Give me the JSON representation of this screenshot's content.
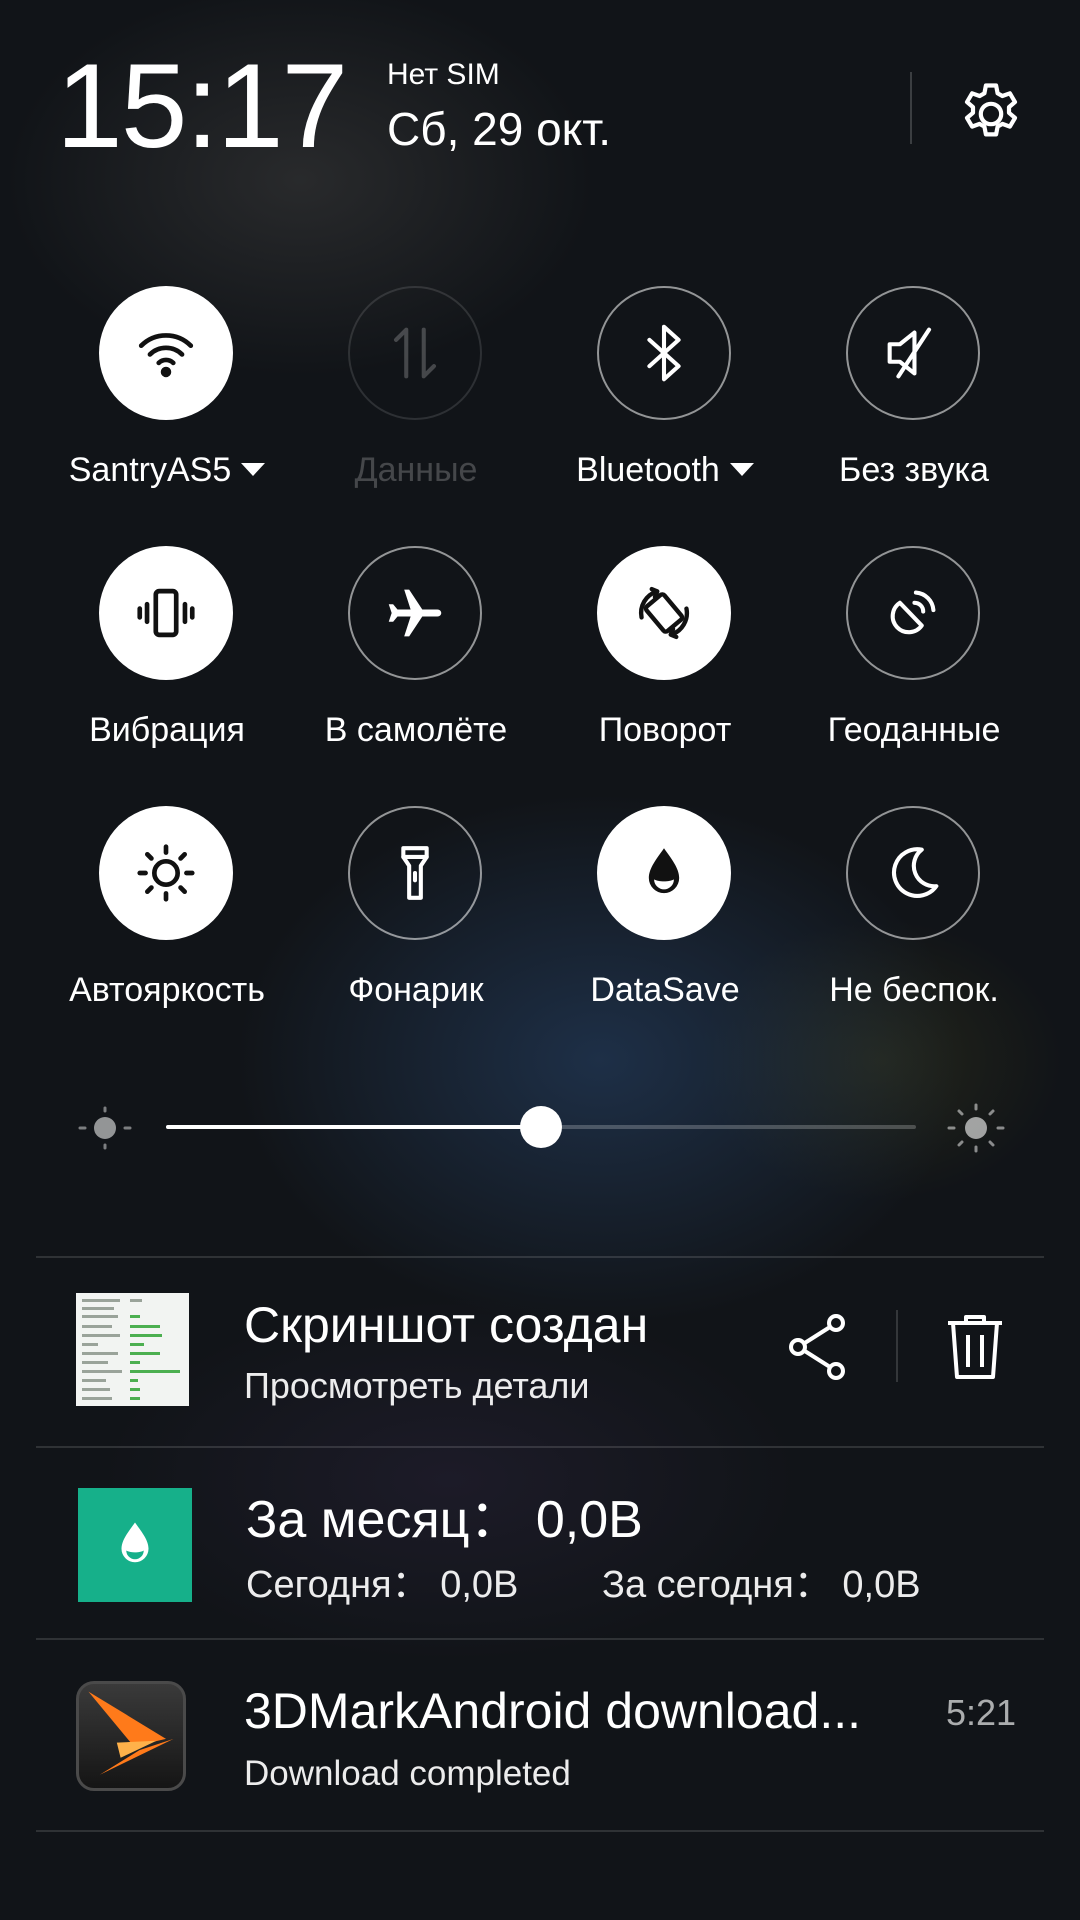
{
  "header": {
    "time": "15:17",
    "sim_status": "Нет SIM",
    "date": "Сб, 29 окт.",
    "settings_icon": "gear-icon"
  },
  "tiles": [
    {
      "label": "SantryAS5",
      "icon": "wifi-icon",
      "state": "on",
      "has_dropdown": true
    },
    {
      "label": "Данные",
      "icon": "mobile-data-icon",
      "state": "disabled",
      "has_dropdown": false
    },
    {
      "label": "Bluetooth",
      "icon": "bluetooth-icon",
      "state": "off",
      "has_dropdown": true
    },
    {
      "label": "Без звука",
      "icon": "mute-icon",
      "state": "off",
      "has_dropdown": false
    },
    {
      "label": "Вибрация",
      "icon": "vibration-icon",
      "state": "on",
      "has_dropdown": false
    },
    {
      "label": "В самолёте",
      "icon": "airplane-icon",
      "state": "off",
      "has_dropdown": false
    },
    {
      "label": "Поворот",
      "icon": "rotation-icon",
      "state": "on",
      "has_dropdown": false
    },
    {
      "label": "Геоданные",
      "icon": "location-icon",
      "state": "off",
      "has_dropdown": false
    },
    {
      "label": "Автояркость",
      "icon": "auto-brightness-icon",
      "state": "on",
      "has_dropdown": false
    },
    {
      "label": "Фонарик",
      "icon": "flashlight-icon",
      "state": "off",
      "has_dropdown": false
    },
    {
      "label": "DataSave",
      "icon": "datasave-icon",
      "state": "on",
      "has_dropdown": false
    },
    {
      "label": "Не беспок.",
      "icon": "moon-icon",
      "state": "off",
      "has_dropdown": false
    }
  ],
  "brightness": {
    "level": 0.5
  },
  "notifications": {
    "screenshot": {
      "title": "Скриншот создан",
      "text": "Просмотреть детали",
      "share_icon": "share-icon",
      "delete_icon": "trash-icon"
    },
    "datasave": {
      "title": "За месяц：  0,0B",
      "today": "Сегодня：  0,0B",
      "today2": "За сегодня：  0,0B"
    },
    "download": {
      "title": "3DMarkAndroid download...",
      "text": "Download completed",
      "time": "5:21"
    }
  },
  "colors": {
    "accent_on": "#ffffff",
    "datasave_green": "#16b08a",
    "mark_orange": "#ff7a1a"
  }
}
